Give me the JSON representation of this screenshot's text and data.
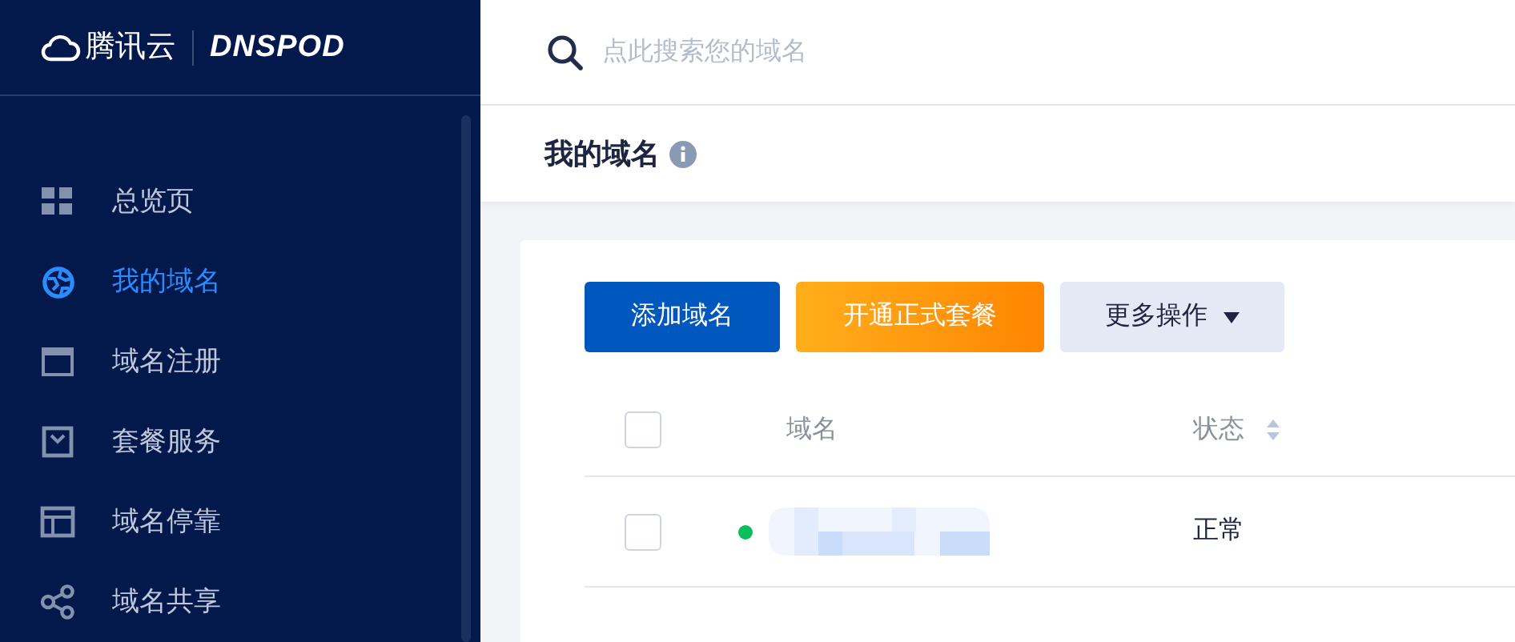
{
  "logo": {
    "brand": "腾讯云",
    "product": "DNSPOD"
  },
  "sidebar": {
    "items": [
      {
        "label": "总览页",
        "kind": "grid",
        "selected": false
      },
      {
        "label": "我的域名",
        "kind": "globe",
        "selected": true
      },
      {
        "label": "域名注册",
        "kind": "window",
        "selected": false
      },
      {
        "label": "套餐服务",
        "kind": "box",
        "selected": false
      },
      {
        "label": "域名停靠",
        "kind": "layout",
        "selected": false
      },
      {
        "label": "域名共享",
        "kind": "share",
        "selected": false
      }
    ]
  },
  "search": {
    "placeholder": "点此搜索您的域名"
  },
  "page_title": "我的域名",
  "toolbar": {
    "buttons": [
      {
        "label": "添加域名",
        "kind": "primary"
      },
      {
        "label": "开通正式套餐",
        "kind": "promo"
      },
      {
        "label": "更多操作",
        "kind": "dropdown"
      }
    ]
  },
  "table": {
    "select_all": {
      "checked": false
    },
    "columns": [
      "域名",
      "状态"
    ],
    "rows": [
      {
        "checked": false,
        "domain": {
          "kind": "redacted"
        },
        "color": "#0abf5b",
        "status": "正常"
      }
    ]
  }
}
